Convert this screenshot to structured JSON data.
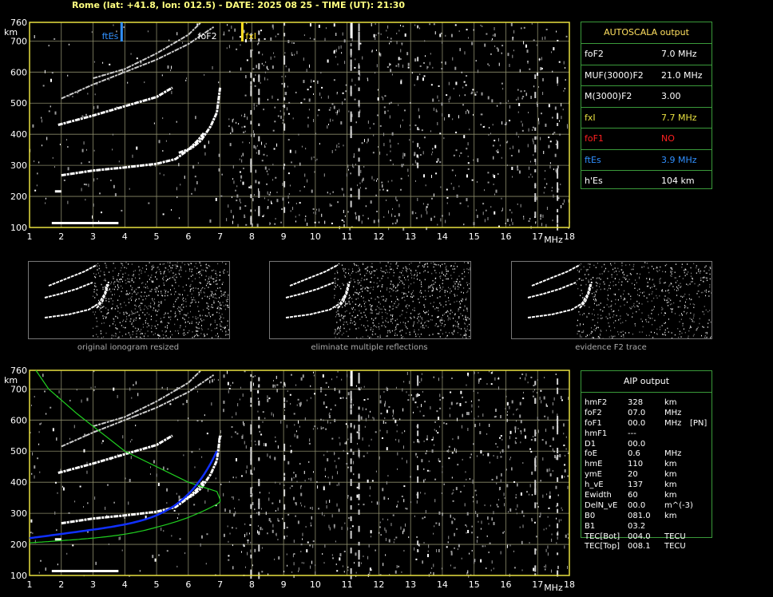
{
  "header": "Rome (lat: +41.8, lon: 012.5) - DATE: 2025 08 25 - TIME (UT): 21:30",
  "axis": {
    "y_ticks": [
      "100",
      "200",
      "300",
      "400",
      "500",
      "600",
      "700",
      "760"
    ],
    "y_unit": "km",
    "x_ticks": [
      "1",
      "2",
      "3",
      "4",
      "5",
      "6",
      "7",
      "8",
      "9",
      "10",
      "11",
      "12",
      "13",
      "14",
      "15",
      "16",
      "17",
      "18"
    ],
    "x_unit": "MHz"
  },
  "markers": {
    "ftEs": "ftEs",
    "foF2": "foF2",
    "fxI": "fxI"
  },
  "autoscala": {
    "title": "AUTOSCALA output",
    "rows": [
      {
        "label": "foF2",
        "value": "7.0 MHz",
        "color": "#ffffff"
      },
      {
        "label": "MUF(3000)F2",
        "value": "21.0 MHz",
        "color": "#ffffff"
      },
      {
        "label": "M(3000)F2",
        "value": "3.00",
        "color": "#ffffff"
      },
      {
        "label": "fxI",
        "value": "7.7 MHz",
        "color": "#e8e040"
      },
      {
        "label": "foF1",
        "value": "NO",
        "color": "#ff2020"
      },
      {
        "label": "ftEs",
        "value": "3.9 MHz",
        "color": "#3090ff"
      },
      {
        "label": "h'Es",
        "value": "104    km",
        "color": "#ffffff"
      }
    ]
  },
  "thumbs": [
    {
      "caption": "original ionogram resized"
    },
    {
      "caption": "eliminate multiple reflections"
    },
    {
      "caption": "evidence F2 trace"
    }
  ],
  "aip": {
    "title": "AIP output",
    "rows": [
      {
        "k": "hmF2",
        "v": "328",
        "u": "km",
        "x": ""
      },
      {
        "k": "foF2",
        "v": "07.0",
        "u": "MHz",
        "x": ""
      },
      {
        "k": "foF1",
        "v": "00.0",
        "u": "MHz",
        "x": "[PN]"
      },
      {
        "k": "hmF1",
        "v": "---",
        "u": "",
        "x": ""
      },
      {
        "k": "D1",
        "v": "00.0",
        "u": "",
        "x": ""
      },
      {
        "k": "foE",
        "v": "0.6",
        "u": "MHz",
        "x": ""
      },
      {
        "k": "hmE",
        "v": "110",
        "u": "km",
        "x": ""
      },
      {
        "k": "ymE",
        "v": "20",
        "u": "km",
        "x": ""
      },
      {
        "k": "h_vE",
        "v": "137",
        "u": "km",
        "x": ""
      },
      {
        "k": "Ewidth",
        "v": "60",
        "u": "km",
        "x": ""
      },
      {
        "k": "DelN_vE",
        "v": "00.0",
        "u": "m^(-3)",
        "x": ""
      },
      {
        "k": "B0",
        "v": "081.0",
        "u": "km",
        "x": ""
      },
      {
        "k": "B1",
        "v": "03.2",
        "u": "",
        "x": ""
      },
      {
        "k": "TEC[Bot]",
        "v": "004.0",
        "u": "TECU",
        "x": ""
      },
      {
        "k": "TEC[Top]",
        "v": "008.1",
        "u": "TECU",
        "x": ""
      }
    ]
  },
  "colors": {
    "grid": "#8a8a6a",
    "frame": "#e8e040",
    "panel": "#3a9a3a",
    "profile_green": "#20d020",
    "profile_blue": "#1030ff"
  }
}
